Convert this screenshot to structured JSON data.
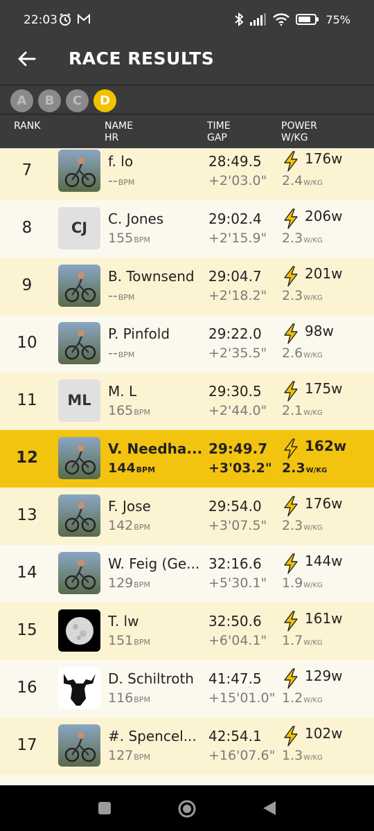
{
  "status": {
    "time": "22:03",
    "battery": "75%"
  },
  "appbar": {
    "title": "RACE RESULTS"
  },
  "categories": [
    {
      "label": "A"
    },
    {
      "label": "B"
    },
    {
      "label": "C"
    },
    {
      "label": "D",
      "active": true
    }
  ],
  "columns": {
    "rank": "RANK",
    "name": "NAME",
    "hr": "HR",
    "time": "TIME",
    "gap": "GAP",
    "power": "POWER",
    "wkg": "W/KG"
  },
  "units": {
    "bpm": "BPM",
    "wkg": "W/KG"
  },
  "results": [
    {
      "rank": "7",
      "name": "f. lo",
      "hr": "--",
      "time": "28:49.5",
      "gap": "+2'03.0\"",
      "power": "176w",
      "wkg": "2.4",
      "avatar": "photo"
    },
    {
      "rank": "8",
      "name": "C. Jones",
      "hr": "155",
      "time": "29:02.4",
      "gap": "+2'15.9\"",
      "power": "206w",
      "wkg": "2.3",
      "avatar": "initials",
      "initials": "CJ"
    },
    {
      "rank": "9",
      "name": "B. Townsend",
      "hr": "--",
      "time": "29:04.7",
      "gap": "+2'18.2\"",
      "power": "201w",
      "wkg": "2.3",
      "avatar": "photo"
    },
    {
      "rank": "10",
      "name": "P. Pinfold",
      "hr": "--",
      "time": "29:22.0",
      "gap": "+2'35.5\"",
      "power": "98w",
      "wkg": "2.6",
      "avatar": "photo"
    },
    {
      "rank": "11",
      "name": "M. L",
      "hr": "165",
      "time": "29:30.5",
      "gap": "+2'44.0\"",
      "power": "175w",
      "wkg": "2.1",
      "avatar": "initials",
      "initials": "ML"
    },
    {
      "rank": "12",
      "name": "V. Needha...",
      "hr": "144",
      "time": "29:49.7",
      "gap": "+3'03.2\"",
      "power": "162w",
      "wkg": "2.3",
      "avatar": "photo",
      "me": true
    },
    {
      "rank": "13",
      "name": "F. Jose",
      "hr": "142",
      "time": "29:54.0",
      "gap": "+3'07.5\"",
      "power": "176w",
      "wkg": "2.3",
      "avatar": "photo"
    },
    {
      "rank": "14",
      "name": "W. Feig (Ge...",
      "hr": "129",
      "time": "32:16.6",
      "gap": "+5'30.1\"",
      "power": "144w",
      "wkg": "1.9",
      "avatar": "photo"
    },
    {
      "rank": "15",
      "name": "T. lw",
      "hr": "151",
      "time": "32:50.6",
      "gap": "+6'04.1\"",
      "power": "161w",
      "wkg": "1.7",
      "avatar": "moon"
    },
    {
      "rank": "16",
      "name": "D. Schiltroth",
      "hr": "116",
      "time": "41:47.5",
      "gap": "+15'01.0\"",
      "power": "129w",
      "wkg": "1.2",
      "avatar": "moose"
    },
    {
      "rank": "17",
      "name": "#. Spencel...",
      "hr": "127",
      "time": "42:54.1",
      "gap": "+16'07.6\"",
      "power": "102w",
      "wkg": "1.3",
      "avatar": "photo"
    }
  ],
  "colors": {
    "accent": "#f2c200",
    "bolt": "#f2c200"
  }
}
